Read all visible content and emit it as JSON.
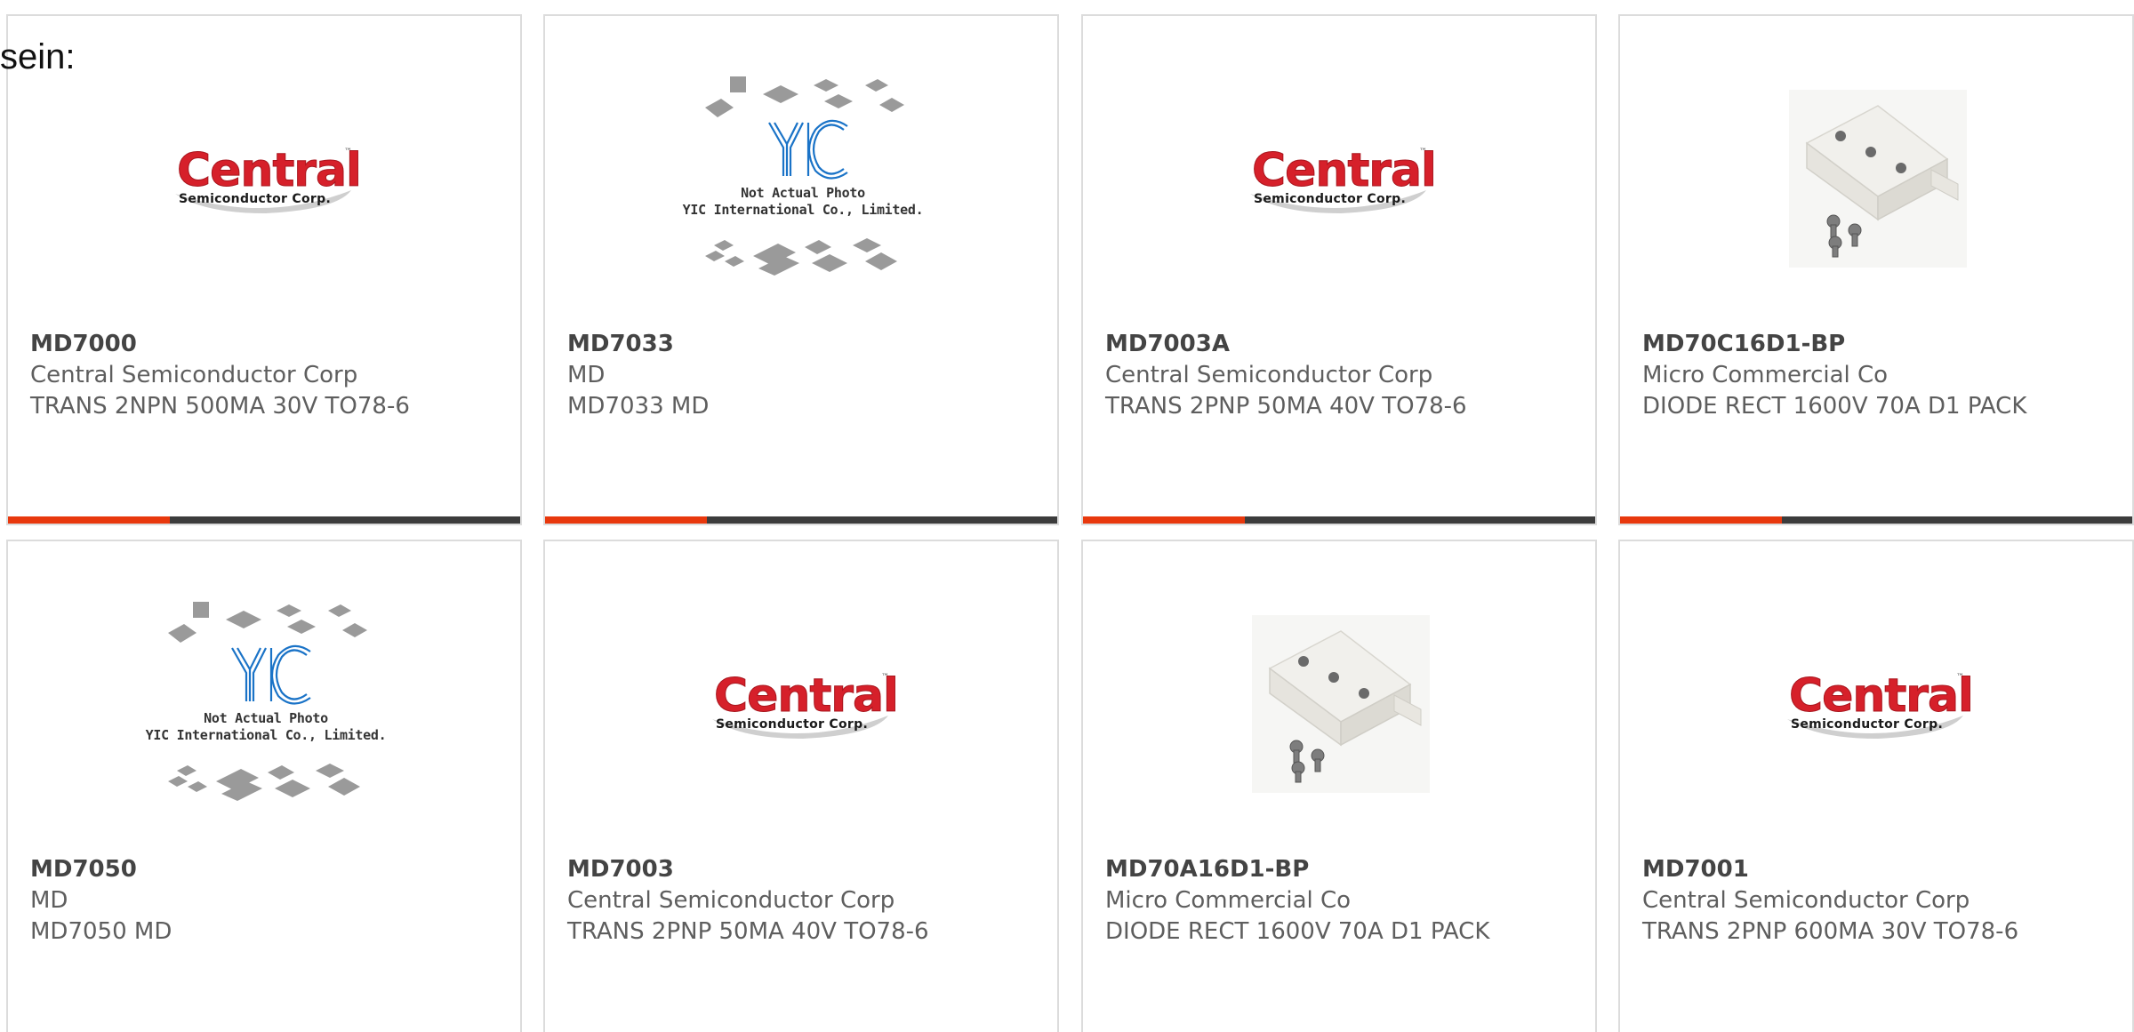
{
  "intro_text": "sein:",
  "colors": {
    "accent_bar": "#e8380d",
    "bar": "#3c3c3c",
    "central_red": "#d6202a",
    "yic_blue": "#1a73c7"
  },
  "logos": {
    "central": {
      "word": "Central",
      "tm": "™",
      "sub": "Semiconductor Corp."
    },
    "yic": {
      "caption_1": "Not Actual Photo",
      "caption_2": "YIC International Co., Limited."
    }
  },
  "products": [
    {
      "part_number": "MD7000",
      "manufacturer": "Central Semiconductor Corp",
      "description": "TRANS 2NPN 500MA 30V TO78-6",
      "image": "central-logo"
    },
    {
      "part_number": "MD7033",
      "manufacturer": "MD",
      "description": "MD7033 MD",
      "image": "yic-placeholder"
    },
    {
      "part_number": "MD7003A",
      "manufacturer": "Central Semiconductor Corp",
      "description": "TRANS 2PNP 50MA 40V TO78-6",
      "image": "central-logo"
    },
    {
      "part_number": "MD70C16D1-BP",
      "manufacturer": "Micro Commercial Co",
      "description": "DIODE RECT 1600V 70A D1 PACK",
      "image": "module-photo"
    },
    {
      "part_number": "MD7050",
      "manufacturer": "MD",
      "description": "MD7050 MD",
      "image": "yic-placeholder"
    },
    {
      "part_number": "MD7003",
      "manufacturer": "Central Semiconductor Corp",
      "description": "TRANS 2PNP 50MA 40V TO78-6",
      "image": "central-logo"
    },
    {
      "part_number": "MD70A16D1-BP",
      "manufacturer": "Micro Commercial Co",
      "description": "DIODE RECT 1600V 70A D1 PACK",
      "image": "module-photo"
    },
    {
      "part_number": "MD7001",
      "manufacturer": "Central Semiconductor Corp",
      "description": "TRANS 2PNP 600MA 30V TO78-6",
      "image": "central-logo"
    }
  ]
}
